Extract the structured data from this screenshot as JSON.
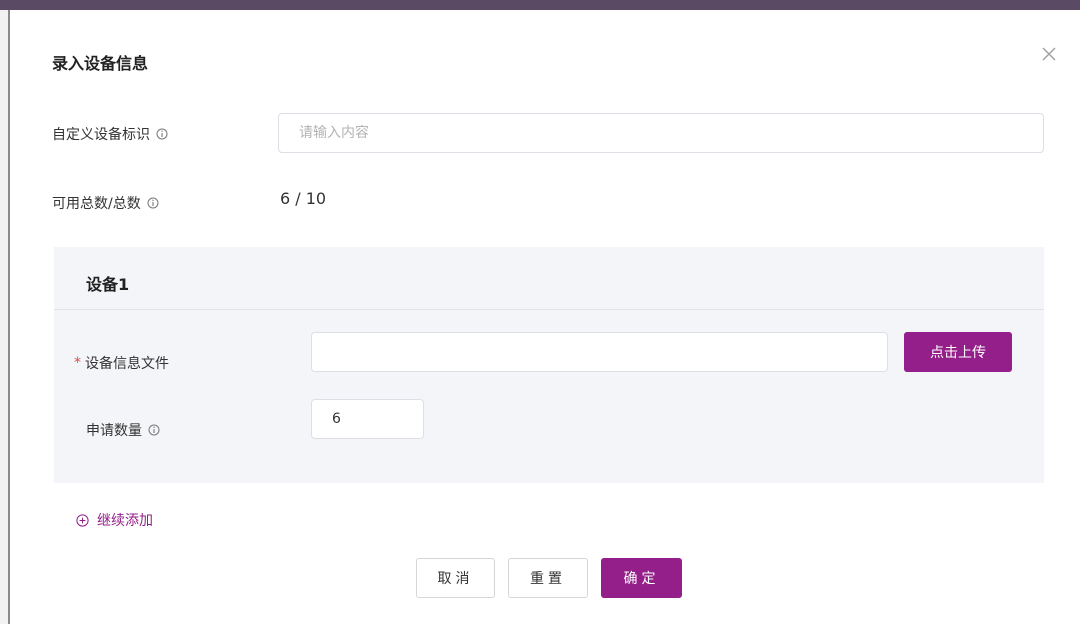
{
  "dialog": {
    "title": "录入设备信息"
  },
  "form": {
    "custom_id": {
      "label": "自定义设备标识",
      "placeholder": "请输入内容",
      "value": ""
    },
    "availability": {
      "label": "可用总数/总数",
      "value": "6 / 10"
    }
  },
  "device": {
    "title": "设备1",
    "file": {
      "required_mark": "*",
      "label": "设备信息文件",
      "value": "",
      "upload_label": "点击上传"
    },
    "quantity": {
      "label": "申请数量",
      "value": "6"
    }
  },
  "add_more_label": "继续添加",
  "footer": {
    "cancel_label": "取消",
    "reset_label": "重置",
    "confirm_label": "确定"
  },
  "colors": {
    "accent": "#941f8a",
    "panel_bg": "#f4f5f8",
    "required": "#e04848"
  },
  "icons": [
    "close-icon",
    "info-icon",
    "plus-circle-icon"
  ]
}
